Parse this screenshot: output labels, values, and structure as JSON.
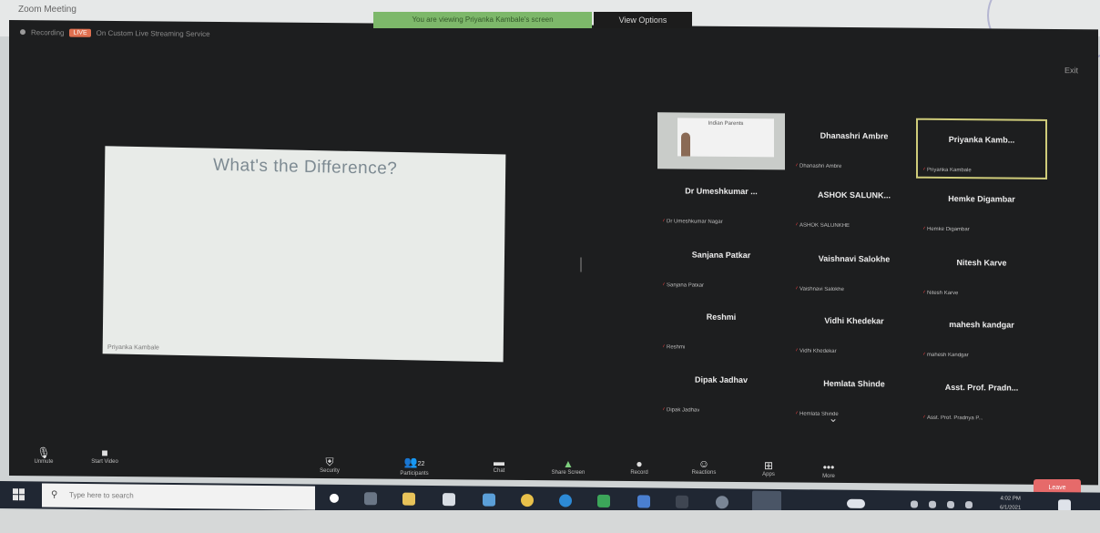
{
  "window": {
    "title": "Zoom Meeting"
  },
  "banner": {
    "text": "You are viewing Priyanka Kambale's screen",
    "view_options": "View Options"
  },
  "topbar": {
    "recording": "Recording",
    "live": "LIVE",
    "live_label": "On Custom Live Streaming Service"
  },
  "exit_fullscreen": "Exit",
  "slide": {
    "title": "What's the Difference?",
    "sharer": "Priyanka Kambale"
  },
  "video_tile": {
    "card_title": "Indian Parents"
  },
  "participants": [
    {
      "big": "Dhanashri Ambre",
      "small": "Dhanashri Ambre",
      "row": 0,
      "col": 1
    },
    {
      "big": "Priyanka  Kamb...",
      "small": "Priyanka Kambale",
      "row": 0,
      "col": 2,
      "highlight": true
    },
    {
      "big": "Dr Umeshkumar ...",
      "small": "Dr Umeshkumar Nagar",
      "row": 1,
      "col": 0
    },
    {
      "big": "ASHOK SALUNK...",
      "small": "ASHOK SALUNKHE",
      "row": 1,
      "col": 1
    },
    {
      "big": "Hemke Digambar",
      "small": "Hemke Digambar",
      "row": 1,
      "col": 2
    },
    {
      "big": "Sanjana Patkar",
      "small": "Sanjana Patkar",
      "row": 2,
      "col": 0
    },
    {
      "big": "Vaishnavi Salokhe",
      "small": "Vaishnavi Salokhe",
      "row": 2,
      "col": 1
    },
    {
      "big": "Nitesh Karve",
      "small": "Nitesh Karve",
      "row": 2,
      "col": 2
    },
    {
      "big": "Reshmi",
      "small": "Reshmi",
      "row": 3,
      "col": 0
    },
    {
      "big": "Vidhi Khedekar",
      "small": "Vidhi Khedekar",
      "row": 3,
      "col": 1
    },
    {
      "big": "mahesh kandgar",
      "small": "mahesh Kandgar",
      "row": 3,
      "col": 2
    },
    {
      "big": "Dipak Jadhav",
      "small": "Dipak Jadhav",
      "row": 4,
      "col": 0
    },
    {
      "big": "Hemlata Shinde",
      "small": "Hemlata Shinde",
      "row": 4,
      "col": 1
    },
    {
      "big": "Asst. Prof. Pradn...",
      "small": "Asst. Prof. Pradnya P...",
      "row": 4,
      "col": 2
    }
  ],
  "controls": {
    "unmute": "Unmute",
    "start_video": "Start Video",
    "security": "Security",
    "participants": "Participants",
    "participants_count": "22",
    "chat": "Chat",
    "share_screen": "Share Screen",
    "record": "Record",
    "reactions": "Reactions",
    "apps": "Apps",
    "more": "More",
    "end": "Leave"
  },
  "taskbar": {
    "search_placeholder": "Type here to search",
    "time": "4:02 PM",
    "date": "6/1/2021"
  },
  "colors": {
    "accent_red": "#e64040",
    "end_button": "#e66a6a",
    "highlight": "#cfcc7a",
    "banner": "#7db86a"
  }
}
